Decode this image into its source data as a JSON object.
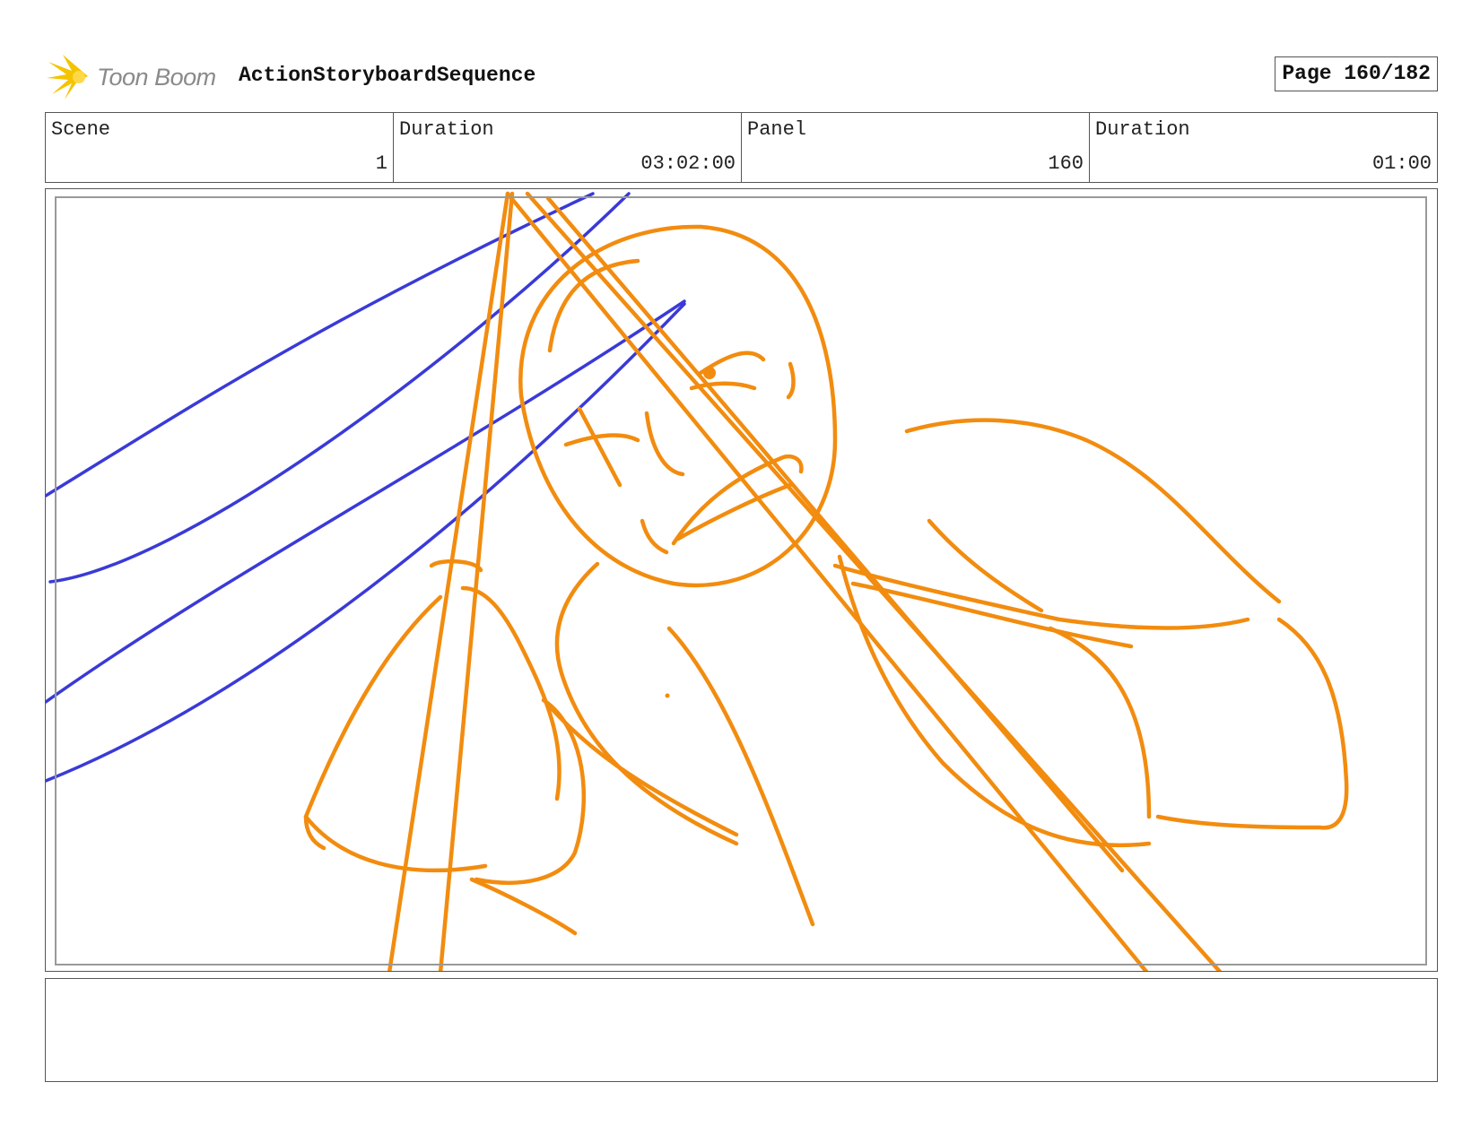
{
  "header": {
    "logo_text": "Toon Boom",
    "sequence_title": "ActionStoryboardSequence",
    "page_label": "Page 160/182"
  },
  "info": {
    "scene_label": "Scene",
    "scene_value": "1",
    "duration_label": "Duration",
    "duration_value": "03:02:00",
    "panel_label": "Panel",
    "panel_value": "160",
    "panel_duration_label": "Duration",
    "panel_duration_value": "01:00"
  },
  "colors": {
    "sketch_orange": "#f28c0f",
    "sketch_blue": "#3a3ad8",
    "frame_border": "#555555"
  },
  "notes": {
    "text": ""
  }
}
